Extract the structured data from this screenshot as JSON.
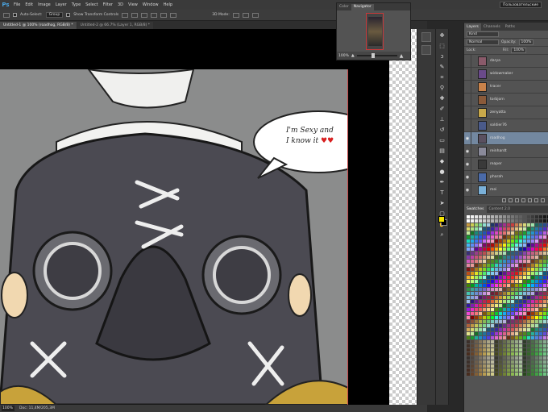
{
  "app": {
    "logo": "Ps",
    "workspace": "Пользовательские"
  },
  "menu": [
    "File",
    "Edit",
    "Image",
    "Layer",
    "Type",
    "Select",
    "Filter",
    "3D",
    "View",
    "Window",
    "Help"
  ],
  "options": {
    "auto_select_label": "Auto-Select:",
    "auto_select_value": "Group",
    "show_transform_label": "Show Transform Controls",
    "mode_label": "3D Mode:"
  },
  "tabs": [
    {
      "label": "Untitled-1 @ 100% (roadhog, RGB/8) *",
      "active": true
    },
    {
      "label": "Untitled-2 @ 66.7% (Layer 1, RGB/8) *",
      "active": false
    }
  ],
  "speech_bubble": {
    "line1": "I'm Sexy and",
    "line2": "I know it"
  },
  "status": {
    "zoom": "100%",
    "doc": "Doc: 11,4M/205,3M"
  },
  "navigator": {
    "tabs": [
      "Color",
      "Navigator"
    ],
    "zoom": "100%"
  },
  "layers_panel": {
    "tabs": [
      "Layers",
      "Channels",
      "Paths"
    ],
    "kind_label": "Kind",
    "blend_mode": "Normal",
    "opacity_label": "Opacity:",
    "opacity_value": "100%",
    "lock_label": "Lock:",
    "fill_label": "Fill:",
    "fill_value": "100%",
    "layers": [
      {
        "name": "darya",
        "visible": false,
        "selected": false,
        "thumb": "#8a5a6a"
      },
      {
        "name": "widowmaker",
        "visible": false,
        "selected": false,
        "thumb": "#6a4a8a"
      },
      {
        "name": "tracer",
        "visible": false,
        "selected": false,
        "thumb": "#c8824a"
      },
      {
        "name": "torbjorn",
        "visible": false,
        "selected": false,
        "thumb": "#8a5a3a"
      },
      {
        "name": "zenyatta",
        "visible": false,
        "selected": false,
        "thumb": "#c8a84a"
      },
      {
        "name": "soldier76",
        "visible": false,
        "selected": false,
        "thumb": "#4a5a8a"
      },
      {
        "name": "roadhog",
        "visible": true,
        "selected": true,
        "thumb": "#5a5060"
      },
      {
        "name": "reinhardt",
        "visible": true,
        "selected": false,
        "thumb": "#8a8a9a"
      },
      {
        "name": "reaper",
        "visible": true,
        "selected": false,
        "thumb": "#3a3a3a"
      },
      {
        "name": "pharah",
        "visible": true,
        "selected": false,
        "thumb": "#4a6aa8"
      },
      {
        "name": "mei",
        "visible": true,
        "selected": false,
        "thumb": "#7ab0d8"
      }
    ]
  },
  "swatches_panel": {
    "tabs": [
      "Swatches",
      "Content 2.0"
    ]
  },
  "colors": {
    "accent": "#7388a0",
    "foreground": "#f5e600",
    "background": "#000000"
  }
}
